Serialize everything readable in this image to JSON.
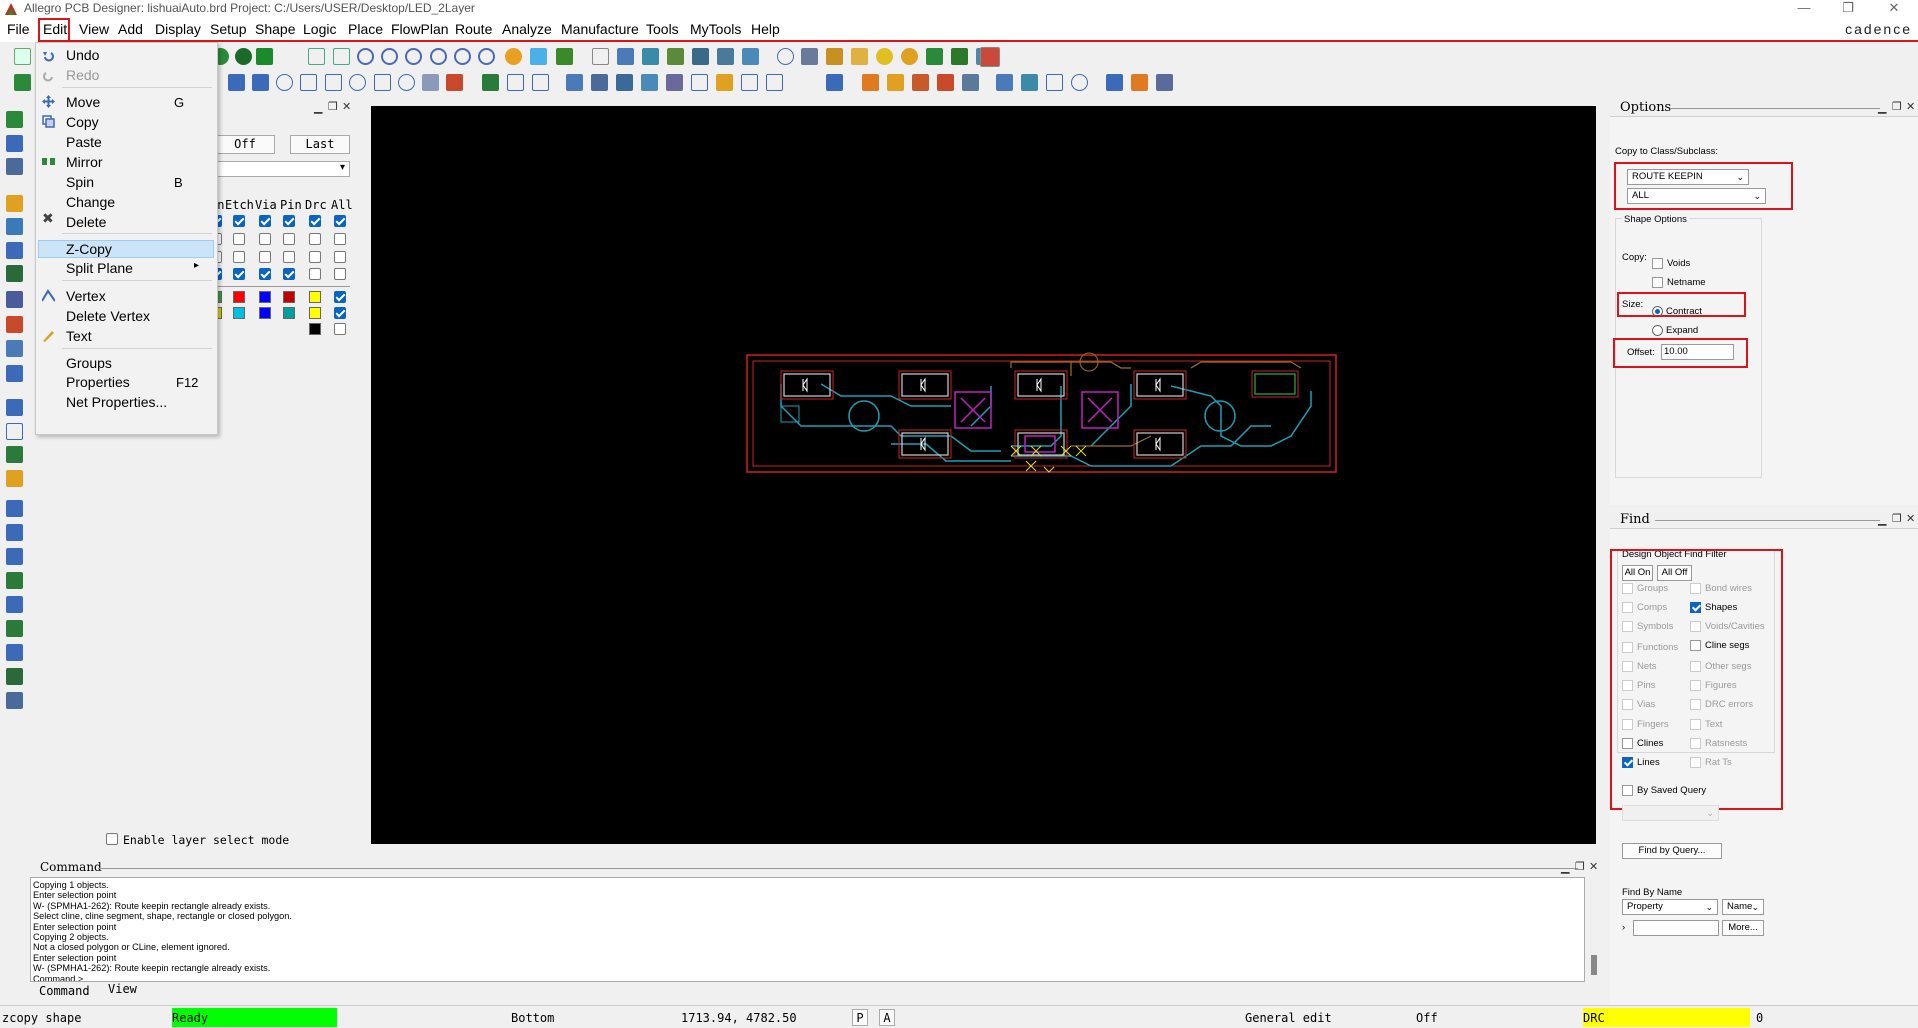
{
  "window": {
    "title": "Allegro PCB Designer: lishuaiAuto.brd  Project: C:/Users/USER/Desktop/LED_2Layer",
    "brand": "cadence",
    "controls": [
      "—",
      "❐",
      "✕"
    ]
  },
  "menubar": {
    "items": [
      "File",
      "Edit",
      "View",
      "Add",
      "Display",
      "Setup",
      "Shape",
      "Logic",
      "Place",
      "FlowPlan",
      "Route",
      "Analyze",
      "Manufacture",
      "Tools",
      "MyTools",
      "Help"
    ]
  },
  "edit_menu": {
    "items": [
      {
        "label": "Undo",
        "shortcut": ""
      },
      {
        "label": "Redo",
        "shortcut": "",
        "disabled": true
      },
      {
        "label": "Move",
        "shortcut": "G"
      },
      {
        "label": "Copy",
        "shortcut": ""
      },
      {
        "label": "Paste",
        "shortcut": ""
      },
      {
        "label": "Mirror",
        "shortcut": ""
      },
      {
        "label": "Spin",
        "shortcut": "B"
      },
      {
        "label": "Change",
        "shortcut": ""
      },
      {
        "label": "Delete",
        "shortcut": ""
      },
      {
        "label": "Z-Copy",
        "shortcut": "",
        "highlighted": true
      },
      {
        "label": "Split Plane",
        "shortcut": "▸"
      },
      {
        "label": "Vertex",
        "shortcut": ""
      },
      {
        "label": "Delete Vertex",
        "shortcut": ""
      },
      {
        "label": "Text",
        "shortcut": ""
      },
      {
        "label": "Groups",
        "shortcut": ""
      },
      {
        "label": "Properties",
        "shortcut": "F12"
      },
      {
        "label": "Net Properties...",
        "shortcut": ""
      }
    ]
  },
  "visibility": {
    "buttons": [
      "Off",
      "Last"
    ],
    "columns": [
      "an",
      "Etch",
      "Via",
      "Pin",
      "Drc",
      "All"
    ],
    "enable_layer_label": "Enable layer select mode"
  },
  "command": {
    "title": "Command",
    "log": [
      "Copying 1 objects.",
      "Enter selection point",
      "W- (SPMHA1-262): Route keepin rectangle already exists.",
      "Select cline, cline segment, shape, rectangle or closed polygon.",
      "Enter selection point",
      "Copying 2 objects.",
      "Not a closed polygon or CLine, element ignored.",
      "Enter selection point",
      "W- (SPMHA1-262): Route keepin rectangle already exists.",
      "Command >"
    ],
    "tabs": [
      "Command",
      "View"
    ]
  },
  "statusbar": {
    "command": "zcopy shape",
    "state": "Ready",
    "layer": "Bottom",
    "coords": "1713.94, 4782.50",
    "p_btn": "P",
    "a_btn": "A",
    "mode": "General edit",
    "off": "Off",
    "drc": "DRC",
    "drc_count": "0",
    "ready_color": "#00ff00",
    "drc_color": "#ffff00"
  },
  "options": {
    "title": "Options",
    "copy_to_label": "Copy to Class/Subclass:",
    "class_value": "ROUTE KEEPIN",
    "subclass_value": "ALL",
    "shape_options_label": "Shape Options",
    "copy_label": "Copy:",
    "voids_label": "Voids",
    "netname_label": "Netname",
    "size_label": "Size:",
    "contract_label": "Contract",
    "expand_label": "Expand",
    "offset_label": "Offset:",
    "offset_value": "10.00"
  },
  "find": {
    "title": "Find",
    "filter_label": "Design Object Find Filter",
    "all_on": "All On",
    "all_off": "All Off",
    "left": [
      {
        "label": "Groups",
        "checked": false,
        "enabled": false
      },
      {
        "label": "Comps",
        "checked": false,
        "enabled": false
      },
      {
        "label": "Symbols",
        "checked": false,
        "enabled": false
      },
      {
        "label": "Functions",
        "checked": false,
        "enabled": false
      },
      {
        "label": "Nets",
        "checked": false,
        "enabled": false
      },
      {
        "label": "Pins",
        "checked": false,
        "enabled": false
      },
      {
        "label": "Vias",
        "checked": false,
        "enabled": false
      },
      {
        "label": "Fingers",
        "checked": false,
        "enabled": false
      },
      {
        "label": "Clines",
        "checked": false,
        "enabled": true
      },
      {
        "label": "Lines",
        "checked": true,
        "enabled": true
      }
    ],
    "right": [
      {
        "label": "Bond wires",
        "checked": false,
        "enabled": false
      },
      {
        "label": "Shapes",
        "checked": true,
        "enabled": true
      },
      {
        "label": "Voids/Cavities",
        "checked": false,
        "enabled": false
      },
      {
        "label": "Cline segs",
        "checked": false,
        "enabled": true
      },
      {
        "label": "Other segs",
        "checked": false,
        "enabled": false
      },
      {
        "label": "Figures",
        "checked": false,
        "enabled": false
      },
      {
        "label": "DRC errors",
        "checked": false,
        "enabled": false
      },
      {
        "label": "Text",
        "checked": false,
        "enabled": false
      },
      {
        "label": "Ratsnests",
        "checked": false,
        "enabled": false
      },
      {
        "label": "Rat Ts",
        "checked": false,
        "enabled": false
      }
    ],
    "by_saved_query": "By Saved Query",
    "find_by_query": "Find by Query...",
    "find_by_name": "Find By Name",
    "property_value": "Property",
    "name_value": "Name",
    "more": "More..."
  }
}
